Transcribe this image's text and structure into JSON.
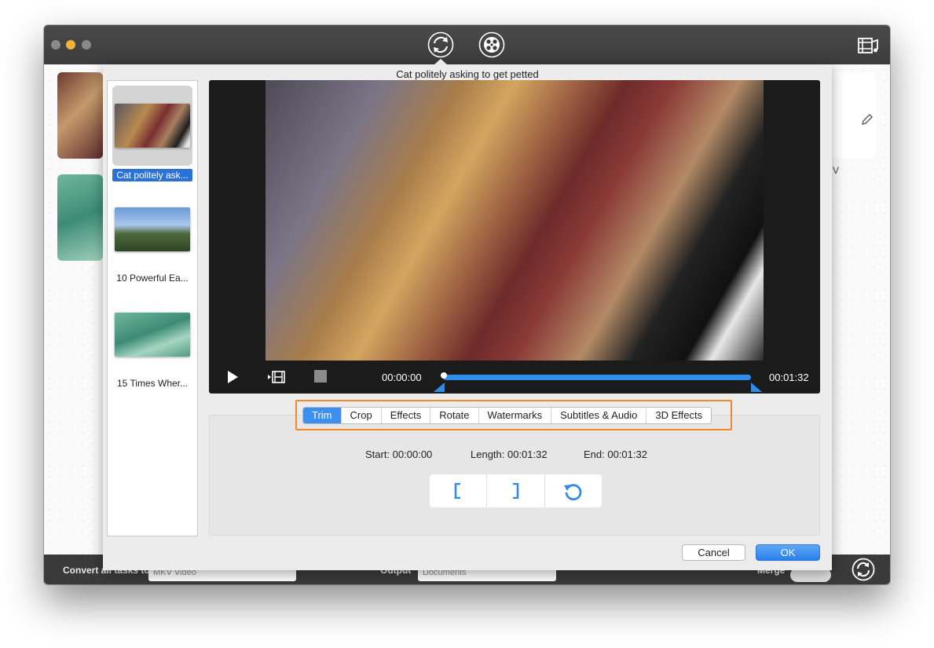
{
  "window": {
    "colors": {
      "accent": "#2e8de8",
      "highlight": "#f08a24",
      "dark": "#3a3a3a"
    }
  },
  "toolbar": {
    "icons": [
      "convert-icon",
      "dvd-burn-icon",
      "media-browser-icon"
    ]
  },
  "background": {
    "truncated_text": "V"
  },
  "footer": {
    "convert_label": "Convert all tasks to",
    "format_value": "MKV Video",
    "output_label": "Output",
    "output_value": "Documents",
    "merge_label": "Merge"
  },
  "dialog": {
    "title": "Cat politely asking to get petted",
    "files": [
      {
        "label": "Cat politely ask..."
      },
      {
        "label": "10 Powerful Ea..."
      },
      {
        "label": "15 Times Wher..."
      }
    ],
    "player": {
      "current_time": "00:00:00",
      "total_time": "00:01:32",
      "progress": 1.0
    },
    "tabs": [
      {
        "label": "Trim",
        "active": true
      },
      {
        "label": "Crop",
        "active": false
      },
      {
        "label": "Effects",
        "active": false
      },
      {
        "label": "Rotate",
        "active": false
      },
      {
        "label": "Watermarks",
        "active": false
      },
      {
        "label": "Subtitles & Audio",
        "active": false
      },
      {
        "label": "3D Effects",
        "active": false
      }
    ],
    "trim": {
      "start": "Start: 00:00:00",
      "length": "Length: 00:01:32",
      "end": "End: 00:01:32"
    },
    "buttons": {
      "cancel": "Cancel",
      "ok": "OK"
    }
  }
}
